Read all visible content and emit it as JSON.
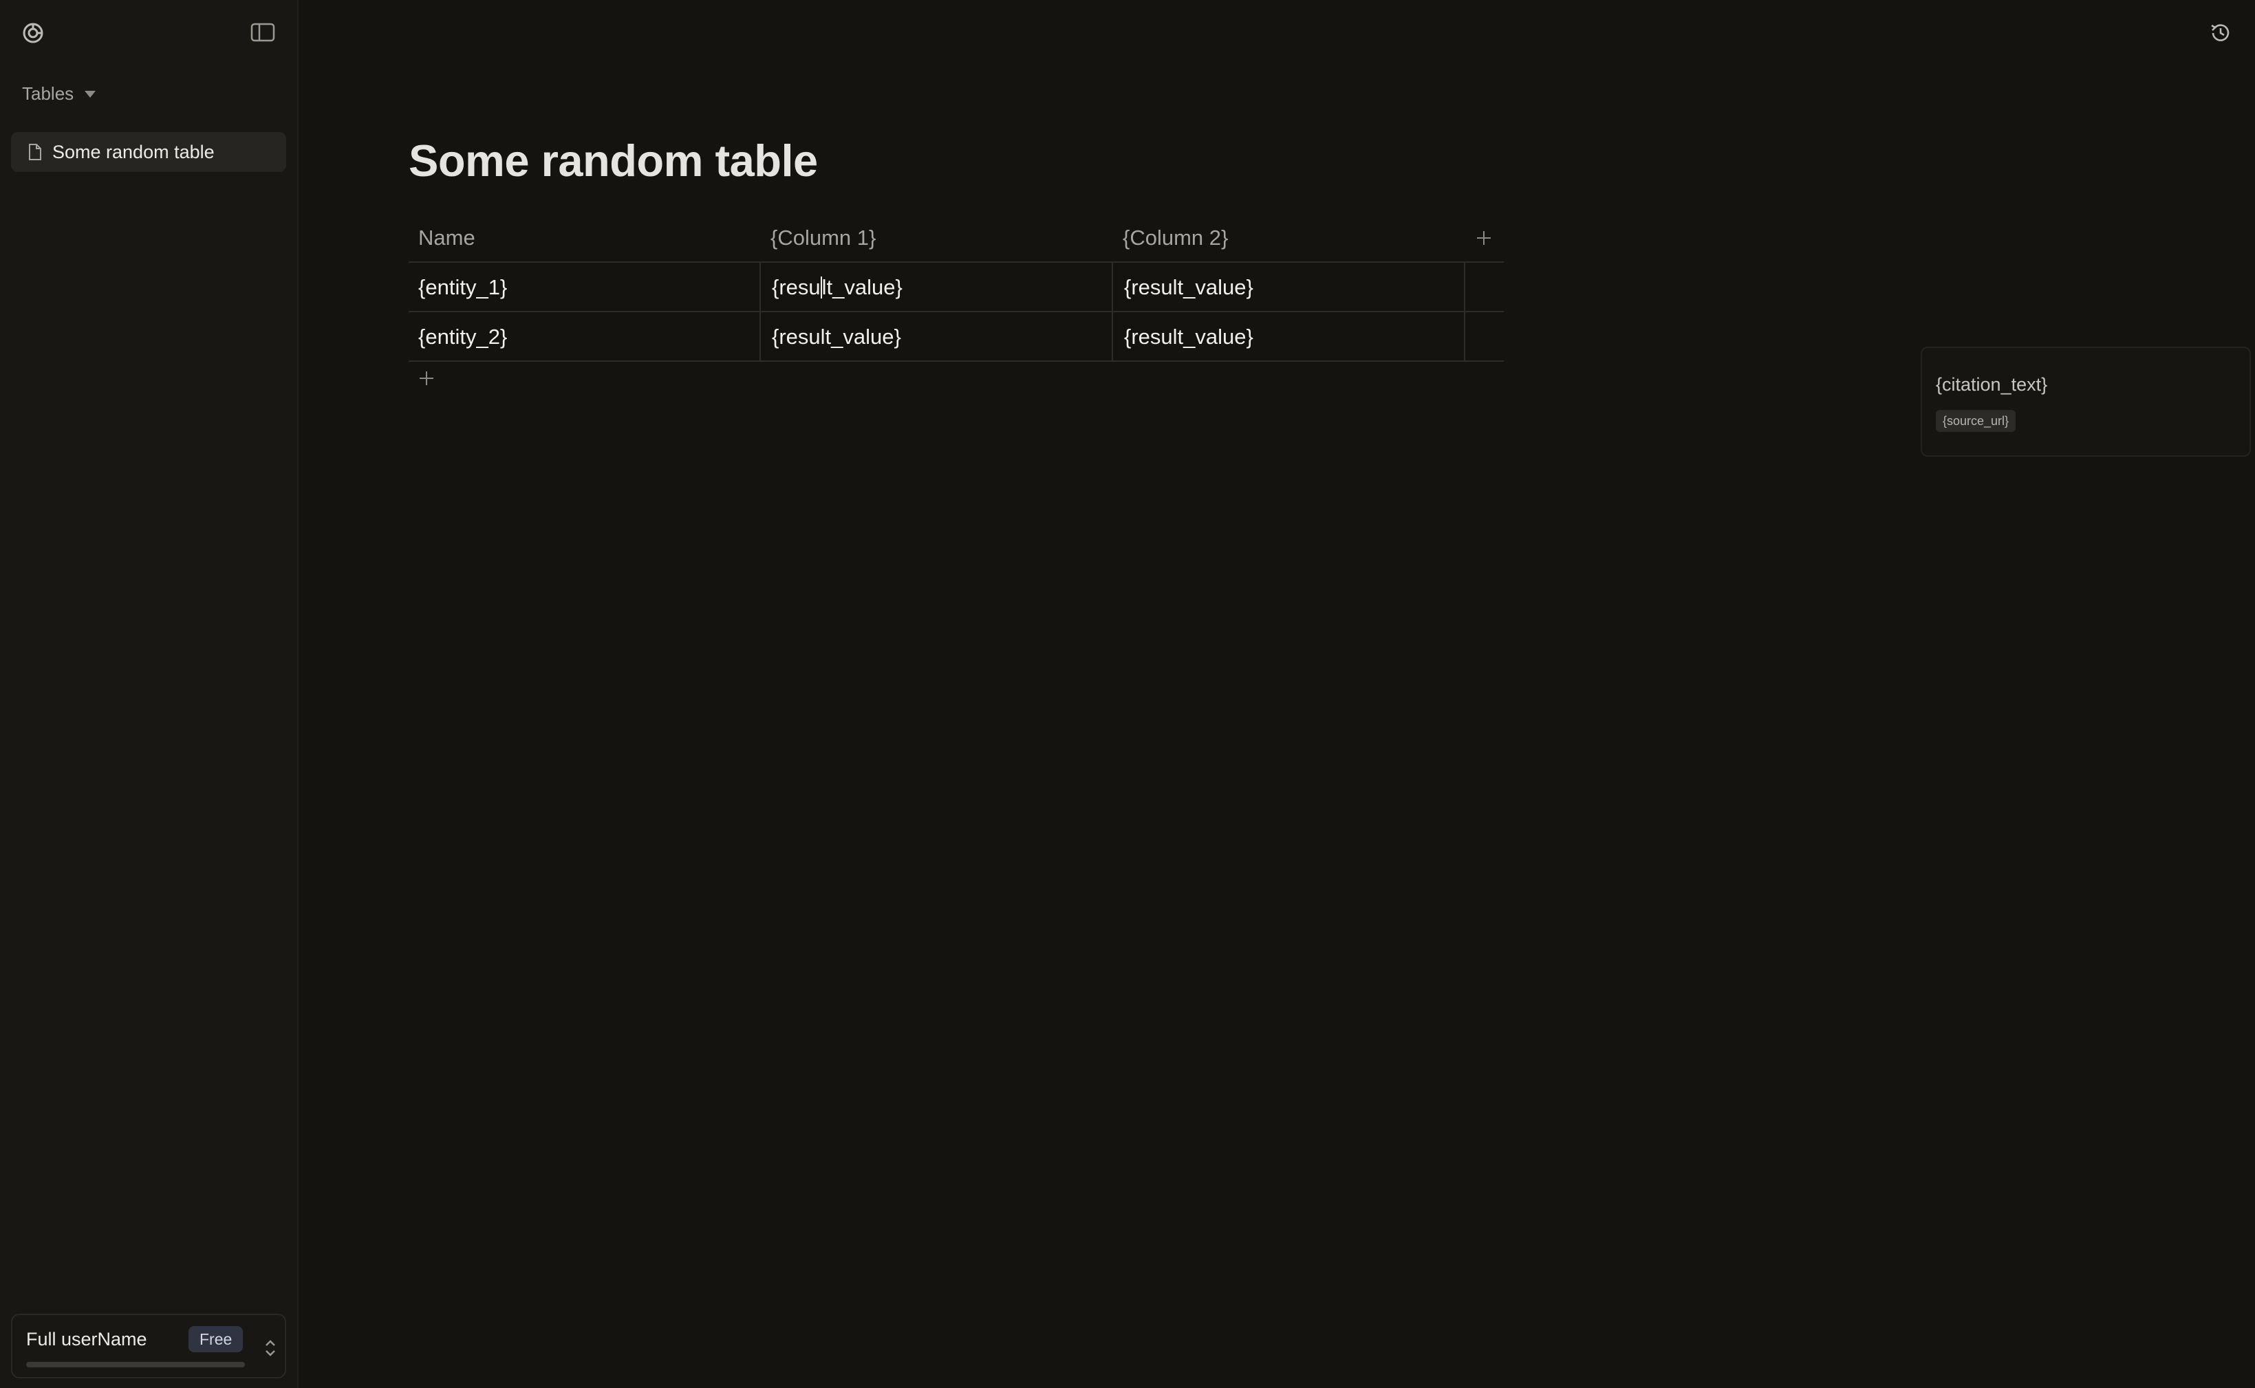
{
  "sidebar": {
    "section_label": "Tables",
    "items": [
      {
        "label": "Some random table",
        "icon": "doc-icon",
        "active": true
      }
    ],
    "user": {
      "name": "Full userName",
      "plan": "Free",
      "usage_fraction": 0.0
    }
  },
  "page": {
    "title": "Some random table"
  },
  "table": {
    "columns": [
      "Name",
      "{Column 1}",
      "{Column 2}"
    ],
    "rows": [
      [
        "{entity_1}",
        "{result_value}",
        "{result_value}"
      ],
      [
        "{entity_2}",
        "{result_value}",
        "{result_value}"
      ]
    ]
  },
  "citation": {
    "text": "{citation_text}",
    "source": "{source_url}"
  },
  "colors": {
    "background": "#141310",
    "sidebar": "#181714",
    "badge": "#2f3440"
  }
}
